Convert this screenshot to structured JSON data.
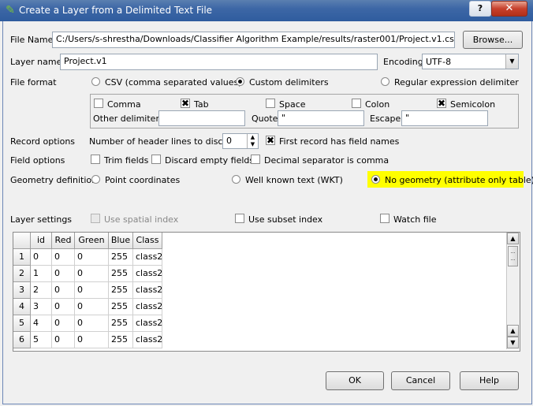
{
  "window": {
    "title": "Create a Layer from a Delimited Text File",
    "help_label": "?",
    "close_label": "✕"
  },
  "file_name": {
    "label": "File Name",
    "value": "C:/Users/s-shrestha/Downloads/Classifier Algorithm Example/results/raster001/Project.v1.csv",
    "browse_label": "Browse..."
  },
  "layer_name": {
    "label": "Layer name",
    "value": "Project.v1"
  },
  "encoding": {
    "label": "Encoding",
    "value": "UTF-8"
  },
  "file_format": {
    "label": "File format",
    "csv_label": "CSV (comma separated values)",
    "custom_label": "Custom delimiters",
    "regex_label": "Regular expression delimiter",
    "selected": "custom"
  },
  "delimiters": {
    "comma": {
      "label": "Comma",
      "checked": false
    },
    "tab": {
      "label": "Tab",
      "checked": true
    },
    "space": {
      "label": "Space",
      "checked": false
    },
    "colon": {
      "label": "Colon",
      "checked": false
    },
    "semicolon": {
      "label": "Semicolon",
      "checked": true
    },
    "other_label": "Other delimiters",
    "other_value": "",
    "quote_label": "Quote",
    "quote_value": "\"",
    "escape_label": "Escape",
    "escape_value": "\""
  },
  "record_options": {
    "label": "Record options",
    "header_lines_label": "Number of header lines to discard",
    "header_lines_value": "0",
    "first_record_label": "First record has field names",
    "first_record_checked": true
  },
  "field_options": {
    "label": "Field options",
    "trim_label": "Trim fields",
    "discard_label": "Discard empty fields",
    "decimal_label": "Decimal separator is comma"
  },
  "geometry": {
    "label": "Geometry definition",
    "point_label": "Point coordinates",
    "wkt_label": "Well known text (WKT)",
    "none_label": "No geometry (attribute only table)",
    "selected": "none",
    "highlight_color": "#ffff00"
  },
  "layer_settings": {
    "label": "Layer settings",
    "spatial_index_label": "Use spatial index",
    "subset_index_label": "Use subset index",
    "watch_label": "Watch file"
  },
  "table": {
    "columns": [
      "id",
      "Red",
      "Green",
      "Blue",
      "Class"
    ],
    "rows": [
      {
        "num": "1",
        "cells": [
          "0",
          "0",
          "0",
          "255",
          "class2"
        ]
      },
      {
        "num": "2",
        "cells": [
          "1",
          "0",
          "0",
          "255",
          "class2"
        ]
      },
      {
        "num": "3",
        "cells": [
          "2",
          "0",
          "0",
          "255",
          "class2"
        ]
      },
      {
        "num": "4",
        "cells": [
          "3",
          "0",
          "0",
          "255",
          "class2"
        ]
      },
      {
        "num": "5",
        "cells": [
          "4",
          "0",
          "0",
          "255",
          "class2"
        ]
      },
      {
        "num": "6",
        "cells": [
          "5",
          "0",
          "0",
          "255",
          "class2"
        ]
      }
    ]
  },
  "buttons": {
    "ok": "OK",
    "cancel": "Cancel",
    "help": "Help"
  },
  "icons": {
    "app": "qgis-icon",
    "check_mark": "✖"
  }
}
